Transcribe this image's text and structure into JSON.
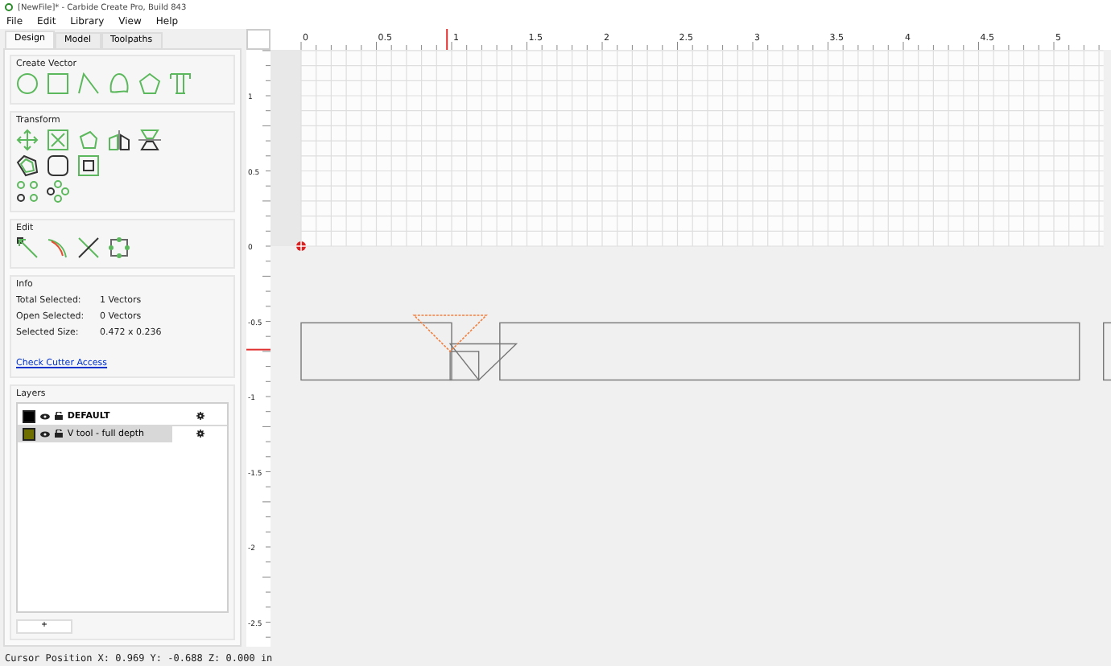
{
  "window": {
    "title": "[NewFile]* - Carbide Create Pro, Build 843"
  },
  "menu": [
    "File",
    "Edit",
    "Library",
    "View",
    "Help"
  ],
  "tabs": [
    {
      "label": "Design",
      "selected": true
    },
    {
      "label": "Model",
      "selected": false
    },
    {
      "label": "Toolpaths",
      "selected": false
    }
  ],
  "sections": {
    "create_vector": {
      "title": "Create Vector"
    },
    "transform": {
      "title": "Transform"
    },
    "edit": {
      "title": "Edit"
    }
  },
  "info": {
    "title": "Info",
    "rows": [
      {
        "label": "Total Selected:",
        "value": "1 Vectors"
      },
      {
        "label": "Open Selected:",
        "value": "0 Vectors"
      },
      {
        "label": "Selected Size:",
        "value": "0.472 x 0.236"
      }
    ],
    "link": "Check Cutter Access"
  },
  "layers": {
    "title": "Layers",
    "items": [
      {
        "name": "DEFAULT",
        "color": "#000000",
        "selected": false
      },
      {
        "name": "V tool - full depth",
        "color": "#6f6f00",
        "selected": true
      }
    ],
    "add_button": "+"
  },
  "rulers": {
    "horizontal": [
      "0",
      "0.5",
      "1",
      "1.5",
      "2",
      "2.5",
      "3",
      "3.5",
      "4",
      "4.5",
      "5"
    ],
    "vertical": [
      "1",
      "0.5",
      "0",
      "-0.5",
      "-1",
      "-1.5",
      "-2",
      "-2.5"
    ]
  },
  "status_bar": "Cursor Position X: 0.969 Y: -0.688 Z: 0.000 in"
}
